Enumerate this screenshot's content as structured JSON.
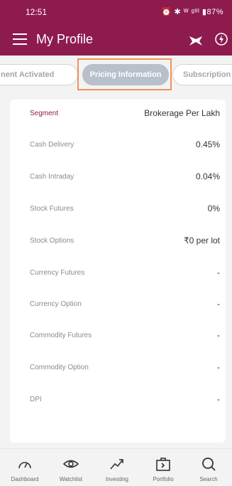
{
  "status_bar": {
    "time": "12:51",
    "battery": "87%",
    "indicators": "⏰ ✱ ᵂ ᵍᴵᴵᴵ ▮87%"
  },
  "app_bar": {
    "title": "My Profile",
    "left_icon": "menu-icon",
    "right_icons": [
      "app-logo-icon",
      "bolt-icon"
    ]
  },
  "tabs": {
    "items": [
      {
        "label": "nent Activated",
        "active": false
      },
      {
        "label": "Pricing Information",
        "active": true
      },
      {
        "label": "Subscription P",
        "active": false
      }
    ]
  },
  "pricing": {
    "header": {
      "segment": "Segment",
      "value": "Brokerage Per Lakh"
    },
    "rows": [
      {
        "label": "Cash Delivery",
        "value": "0.45%"
      },
      {
        "label": "Cash Intraday",
        "value": "0.04%"
      },
      {
        "label": "Stock Futures",
        "value": "0%"
      },
      {
        "label": "Stock Options",
        "value": "₹0 per lot"
      },
      {
        "label": "Currency Futures",
        "value": "-"
      },
      {
        "label": "Currency Option",
        "value": "-"
      },
      {
        "label": "Commodity Futures",
        "value": "-"
      },
      {
        "label": "Commodity Option",
        "value": "-"
      },
      {
        "label": "DPI",
        "value": "-"
      }
    ]
  },
  "bottom_nav": [
    {
      "label": "Dashboard",
      "icon": "gauge-icon"
    },
    {
      "label": "Watchlist",
      "icon": "eye-icon"
    },
    {
      "label": "Investing",
      "icon": "trend-icon"
    },
    {
      "label": "Portfolio",
      "icon": "portfolio-icon"
    },
    {
      "label": "Search",
      "icon": "search-icon"
    }
  ],
  "colors": {
    "brand": "#8e1b4e",
    "active_tab": "#b8c0ca",
    "focus_outline": "#f0925a"
  }
}
